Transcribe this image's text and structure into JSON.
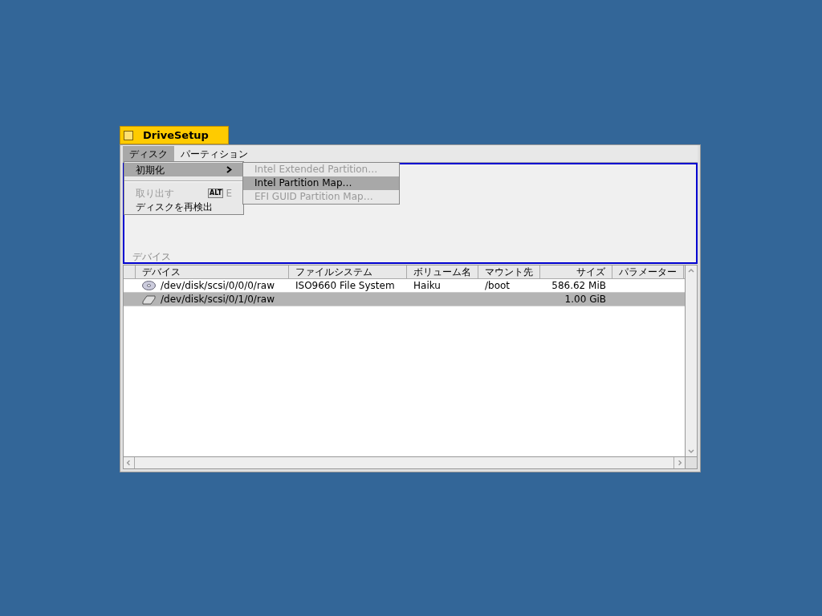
{
  "window": {
    "title": "DriveSetup"
  },
  "menubar": [
    {
      "label": "ディスク",
      "selected": true
    },
    {
      "label": "パーティション",
      "selected": false
    }
  ],
  "disk_menu": [
    {
      "kind": "submenu",
      "label": "初期化",
      "selected": true,
      "disabled": false
    },
    {
      "kind": "separator"
    },
    {
      "kind": "item",
      "label": "取り出す",
      "shortcut": "E",
      "modifier": "ALT",
      "disabled": true,
      "selected": false
    },
    {
      "kind": "item",
      "label": "ディスクを再検出",
      "disabled": false,
      "selected": false
    }
  ],
  "submenu": [
    {
      "label": "Intel Extended Partition…",
      "disabled": true,
      "selected": false
    },
    {
      "label": "Intel Partition Map…",
      "disabled": false,
      "selected": true
    },
    {
      "label": "EFI GUID Partition Map…",
      "disabled": true,
      "selected": false
    }
  ],
  "map_label": "デバイス",
  "table": {
    "columns": [
      "デバイス",
      "ファイルシステム",
      "ボリューム名",
      "マウント先",
      "サイズ",
      "パラメーター"
    ],
    "rows": [
      {
        "kind": "cd",
        "selected": false,
        "cells": [
          "/dev/disk/scsi/0/0/0/raw",
          "ISO9660 File System",
          "Haiku",
          "/boot",
          "586.62 MiB",
          ""
        ]
      },
      {
        "kind": "disk",
        "selected": true,
        "cells": [
          "/dev/disk/scsi/0/1/0/raw",
          "",
          "",
          "",
          "1.00 GiB",
          ""
        ]
      }
    ]
  }
}
